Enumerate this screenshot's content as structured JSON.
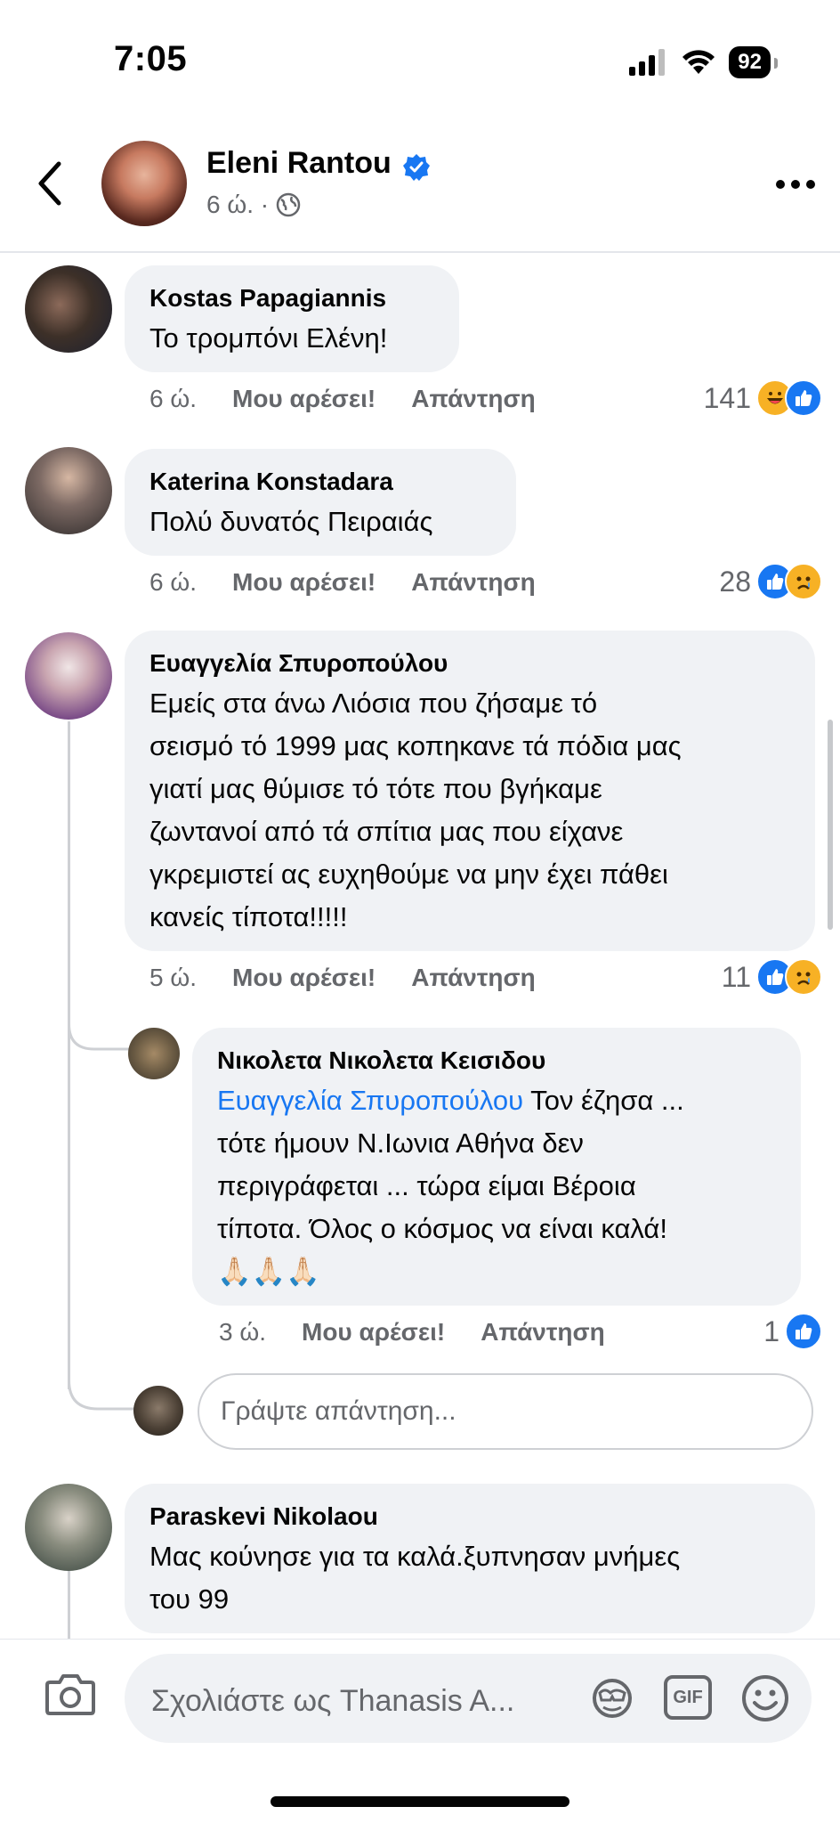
{
  "status_bar": {
    "time": "7:05",
    "battery": "92"
  },
  "header": {
    "name": "Eleni Rantou",
    "meta": "6 ώ. ·"
  },
  "comments": [
    {
      "author": "Kostas Papagiannis",
      "text": [
        "Το τρομπόνι Ελένη!"
      ],
      "time": "6 ώ.",
      "like": "Μου αρέσει!",
      "reply": "Απάντηση",
      "reactions": "141"
    },
    {
      "author": "Katerina Konstadara",
      "text": [
        "Πολύ δυνατός Πειραιάς"
      ],
      "time": "6 ώ.",
      "like": "Μου αρέσει!",
      "reply": "Απάντηση",
      "reactions": "28"
    },
    {
      "author": "Ευαγγελία Σπυροπούλου",
      "text": [
        "Εμείς στα άνω Λιόσια που ζήσαμε τό",
        "σεισμό τό 1999 μας κοπηκανε τά πόδια μας",
        "γιατί μας θύμισε τό τότε που βγήκαμε",
        "ζωντανοί από τά σπίτια μας που είχανε",
        "γκρεμιστεί ας ευχηθούμε να μην έχει πάθει",
        "κανείς τίποτα!!!!!"
      ],
      "time": "5 ώ.",
      "like": "Μου αρέσει!",
      "reply": "Απάντηση",
      "reactions": "11"
    },
    {
      "author": "Παρασκευή",
      "text": [],
      "time": "",
      "like": "",
      "reply": "",
      "reactions": ""
    }
  ],
  "reply": {
    "author": "Νικολετα Νικολετα Κεισιδου",
    "mention": "Ευαγγελία Σπυροπούλου",
    "first_line_rest": " Τον έζησα  ...",
    "lines": [
      "τότε  ήμουν Ν.Ιωνια Αθήνα δεν",
      "περιγράφεται  ... τώρα είμαι Βέροια",
      "τίποτα. Όλος ο κόσμος  να είναι καλά!",
      "🙏🏻🙏🏻🙏🏻"
    ],
    "time": "3 ώ.",
    "like": "Μου αρέσει!",
    "reply": "Απάντηση",
    "reactions": "1"
  },
  "reply_input": {
    "placeholder": "Γράψτε απάντηση..."
  },
  "last_comment": {
    "author": "Paraskevi Nikolaou",
    "lines": [
      "Μας κούνησε για τα καλά.ξυπνησαν μνήμες",
      "του 99"
    ]
  },
  "composer": {
    "placeholder": "Σχολιάστε ως Thanasis A...",
    "gif": "GIF"
  }
}
